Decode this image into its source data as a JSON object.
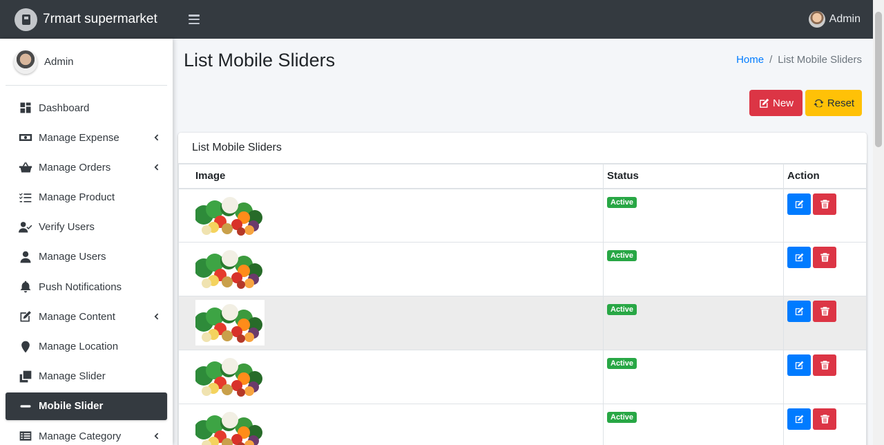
{
  "app": {
    "brand": "7rmart supermarket",
    "top_user": "Admin"
  },
  "sidebar": {
    "user": "Admin",
    "items": [
      {
        "label": "Dashboard",
        "icon": "dashboard-icon",
        "chevron": false,
        "active": false
      },
      {
        "label": "Manage Expense",
        "icon": "money-bill-icon",
        "chevron": true,
        "active": false
      },
      {
        "label": "Manage Orders",
        "icon": "basket-icon",
        "chevron": true,
        "active": false
      },
      {
        "label": "Manage Product",
        "icon": "tasks-icon",
        "chevron": false,
        "active": false
      },
      {
        "label": "Verify Users",
        "icon": "user-check-icon",
        "chevron": false,
        "active": false
      },
      {
        "label": "Manage Users",
        "icon": "user-icon",
        "chevron": false,
        "active": false
      },
      {
        "label": "Push Notifications",
        "icon": "bell-icon",
        "chevron": false,
        "active": false
      },
      {
        "label": "Manage Content",
        "icon": "edit-icon",
        "chevron": true,
        "active": false
      },
      {
        "label": "Manage Location",
        "icon": "map-marker-icon",
        "chevron": false,
        "active": false
      },
      {
        "label": "Manage Slider",
        "icon": "clone-icon",
        "chevron": false,
        "active": false
      },
      {
        "label": "Mobile Slider",
        "icon": "minus-icon",
        "chevron": false,
        "active": true
      },
      {
        "label": "Manage Category",
        "icon": "list-icon",
        "chevron": true,
        "active": false
      }
    ]
  },
  "page": {
    "title": "List Mobile Sliders"
  },
  "breadcrumb": {
    "home": "Home",
    "sep": "/",
    "current": "List Mobile Sliders"
  },
  "buttons": {
    "new": "New",
    "reset": "Reset"
  },
  "card": {
    "title": "List Mobile Sliders"
  },
  "table": {
    "headers": {
      "image": "Image",
      "status": "Status",
      "action": "Action"
    },
    "rows": [
      {
        "status": "Active"
      },
      {
        "status": "Active"
      },
      {
        "status": "Active"
      },
      {
        "status": "Active"
      },
      {
        "status": "Active"
      }
    ]
  },
  "colors": {
    "primary": "#007bff",
    "danger": "#dc3545",
    "warning": "#ffc107",
    "success": "#28a745",
    "dark": "#343a40"
  }
}
